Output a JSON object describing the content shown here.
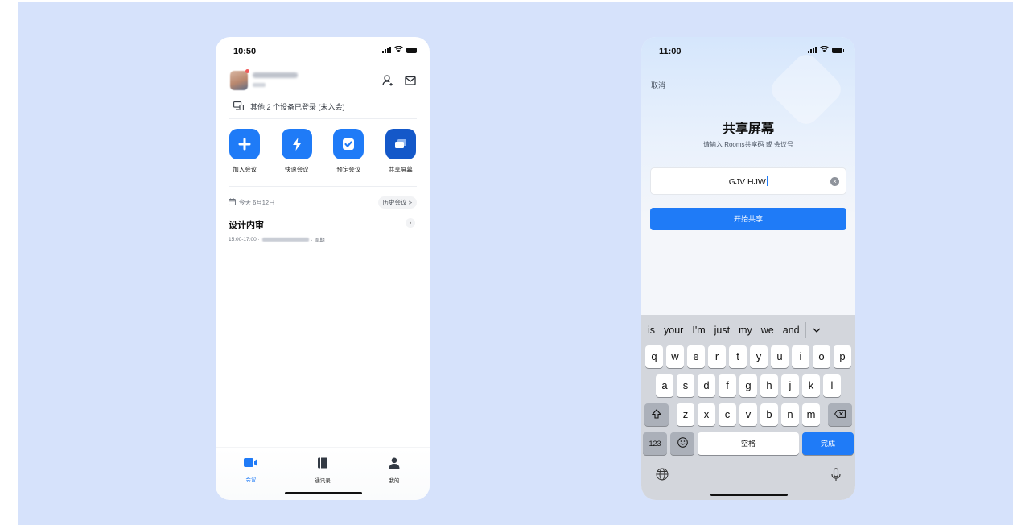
{
  "left_phone": {
    "status_time": "10:50",
    "devices_notice": "其他 2 个设备已登录 (未入会)",
    "actions": [
      {
        "label": "加入会议",
        "icon": "plus-icon"
      },
      {
        "label": "快速会议",
        "icon": "lightning-icon"
      },
      {
        "label": "预定会议",
        "icon": "check-icon"
      },
      {
        "label": "共享屏幕",
        "icon": "share-screen-icon"
      }
    ],
    "date_label": "今天 6月12日",
    "history_button": "历史会议 >",
    "meeting": {
      "title": "设计内审",
      "time": "15:00-17:00 ·",
      "recurrence": "· 周期"
    },
    "tabs": [
      {
        "label": "会议",
        "icon": "video-icon",
        "active": true
      },
      {
        "label": "通讯录",
        "icon": "contacts-book-icon",
        "active": false
      },
      {
        "label": "我的",
        "icon": "person-icon",
        "active": false
      }
    ]
  },
  "right_phone": {
    "status_time": "11:00",
    "cancel_label": "取消",
    "title": "共享屏幕",
    "subtitle": "请输入 Rooms共享码 或 会议号",
    "code_value": "GJV HJW",
    "start_button": "开始共享",
    "keyboard": {
      "suggestions": [
        "is",
        "your",
        "I'm",
        "just",
        "my",
        "we",
        "and"
      ],
      "row1": [
        "q",
        "w",
        "e",
        "r",
        "t",
        "y",
        "u",
        "i",
        "o",
        "p"
      ],
      "row2": [
        "a",
        "s",
        "d",
        "f",
        "g",
        "h",
        "j",
        "k",
        "l"
      ],
      "row3": [
        "z",
        "x",
        "c",
        "v",
        "b",
        "n",
        "m"
      ],
      "num_key": "123",
      "space_key": "空格",
      "done_key": "完成"
    }
  },
  "colors": {
    "background": "#d6e2fb",
    "accent": "#1f7bf7"
  }
}
